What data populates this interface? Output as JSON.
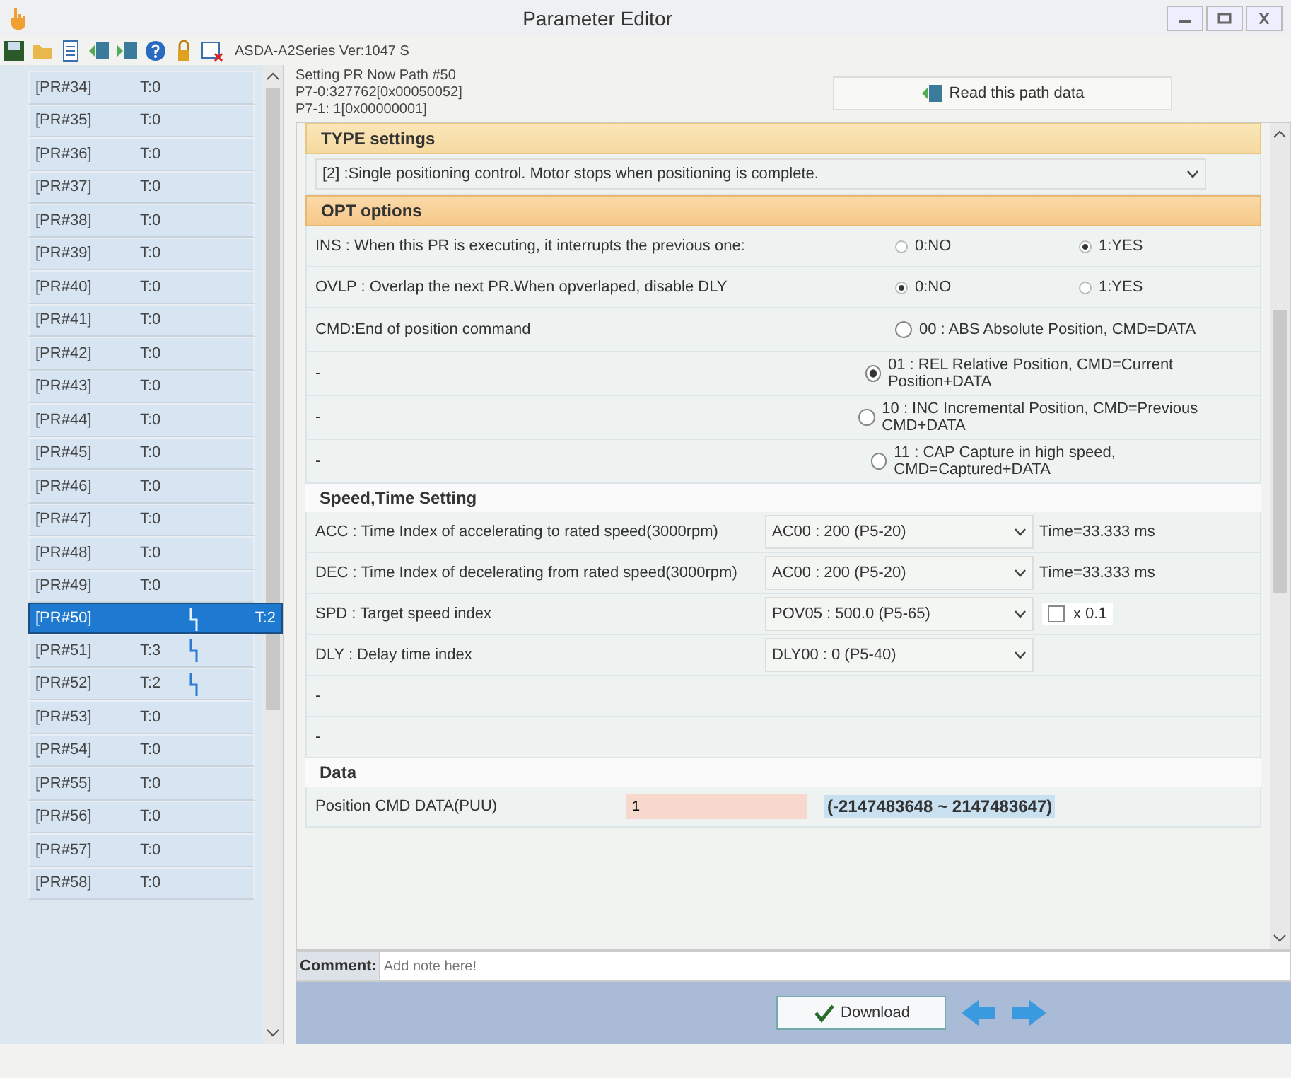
{
  "window": {
    "title": "Parameter Editor"
  },
  "toolbar": {
    "text": "ASDA-A2Series Ver:1047 S"
  },
  "pr_list": [
    {
      "label": "[PR#34]",
      "t": "T:0",
      "selected": false
    },
    {
      "label": "[PR#35]",
      "t": "T:0",
      "selected": false
    },
    {
      "label": "[PR#36]",
      "t": "T:0",
      "selected": false
    },
    {
      "label": "[PR#37]",
      "t": "T:0",
      "selected": false
    },
    {
      "label": "[PR#38]",
      "t": "T:0",
      "selected": false
    },
    {
      "label": "[PR#39]",
      "t": "T:0",
      "selected": false
    },
    {
      "label": "[PR#40]",
      "t": "T:0",
      "selected": false
    },
    {
      "label": "[PR#41]",
      "t": "T:0",
      "selected": false
    },
    {
      "label": "[PR#42]",
      "t": "T:0",
      "selected": false
    },
    {
      "label": "[PR#43]",
      "t": "T:0",
      "selected": false
    },
    {
      "label": "[PR#44]",
      "t": "T:0",
      "selected": false
    },
    {
      "label": "[PR#45]",
      "t": "T:0",
      "selected": false
    },
    {
      "label": "[PR#46]",
      "t": "T:0",
      "selected": false
    },
    {
      "label": "[PR#47]",
      "t": "T:0",
      "selected": false
    },
    {
      "label": "[PR#48]",
      "t": "T:0",
      "selected": false
    },
    {
      "label": "[PR#49]",
      "t": "T:0",
      "selected": false
    },
    {
      "label": "[PR#50]",
      "t": "T:2",
      "selected": true,
      "linked": true
    },
    {
      "label": "[PR#51]",
      "t": "T:3",
      "selected": false,
      "linked": true
    },
    {
      "label": "[PR#52]",
      "t": "T:2",
      "selected": false,
      "linked": true
    },
    {
      "label": "[PR#53]",
      "t": "T:0",
      "selected": false
    },
    {
      "label": "[PR#54]",
      "t": "T:0",
      "selected": false
    },
    {
      "label": "[PR#55]",
      "t": "T:0",
      "selected": false
    },
    {
      "label": "[PR#56]",
      "t": "T:0",
      "selected": false
    },
    {
      "label": "[PR#57]",
      "t": "T:0",
      "selected": false
    },
    {
      "label": "[PR#58]",
      "t": "T:0",
      "selected": false
    }
  ],
  "path_info": [
    "Setting PR Now Path #50",
    "P7-0:327762[0x00050052]",
    "P7-1: 1[0x00000001]"
  ],
  "read_button": "Read this path data",
  "type_settings": {
    "title": "TYPE settings",
    "value": "[2] :Single positioning control.  Motor stops when positioning is complete."
  },
  "opt_options": {
    "title": "OPT options",
    "rows": [
      {
        "label": "INS : When this PR is executing, it interrupts the previous one:",
        "options": [
          {
            "label": "0:NO",
            "selected": false
          },
          {
            "label": "1:YES",
            "selected": true
          }
        ]
      },
      {
        "label": "OVLP : Overlap the next PR.When opverlaped, disable DLY",
        "options": [
          {
            "label": "0:NO",
            "selected": true
          },
          {
            "label": "1:YES",
            "selected": false
          }
        ]
      }
    ]
  },
  "cmd": {
    "rows": [
      {
        "label": "CMD:End of position command",
        "option": {
          "label": "00 : ABS Absolute Position, CMD=DATA",
          "selected": false
        }
      },
      {
        "label": "-",
        "option": {
          "label": "01 : REL Relative Position, CMD=Current Position+DATA",
          "selected": true
        }
      },
      {
        "label": "-",
        "option": {
          "label": "10 : INC Incremental Position, CMD=Previous CMD+DATA",
          "selected": false
        }
      },
      {
        "label": "-",
        "option": {
          "label": "11 : CAP Capture in high speed, CMD=Captured+DATA",
          "selected": false
        }
      }
    ]
  },
  "speed": {
    "title": "Speed,Time Setting",
    "rows": [
      {
        "kind": "select_note",
        "label": "ACC : Time Index of accelerating to rated speed(3000rpm)",
        "select": "AC00 : 200 (P5-20)",
        "note": "Time=33.333 ms"
      },
      {
        "kind": "select_note",
        "label": "DEC : Time Index of decelerating from rated speed(3000rpm)",
        "select": "AC00 : 200 (P5-20)",
        "note": "Time=33.333 ms"
      },
      {
        "kind": "select_check",
        "label": "SPD : Target speed index",
        "select": "POV05 : 500.0 (P5-65)",
        "checked": false,
        "check_label": "x 0.1"
      },
      {
        "kind": "select",
        "label": "DLY : Delay time index",
        "select": "DLY00 : 0 (P5-40)"
      },
      {
        "kind": "empty",
        "label": "-"
      },
      {
        "kind": "empty",
        "label": "-"
      }
    ]
  },
  "data": {
    "title": "Data",
    "label": "Position CMD DATA(PUU)",
    "value": "1",
    "range": "(-2147483648 ~ 2147483647)"
  },
  "comment": {
    "label": "Comment:",
    "placeholder": "Add note here!"
  },
  "download_button": "Download"
}
